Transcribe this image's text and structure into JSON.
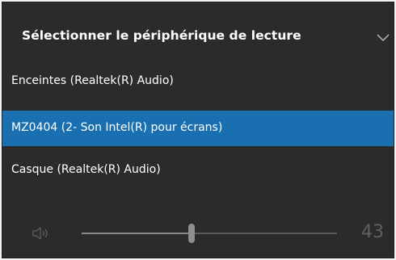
{
  "header": {
    "title": "Sélectionner le périphérique de lecture",
    "chevron_icon": "chevron-down-icon"
  },
  "devices": [
    {
      "label": "Enceintes (Realtek(R) Audio)",
      "selected": false
    },
    {
      "label": "MZ0404 (2- Son Intel(R) pour écrans)",
      "selected": true
    },
    {
      "label": "Casque (Realtek(R) Audio)",
      "selected": false
    }
  ],
  "volume": {
    "icon": "speaker-icon",
    "level": 43,
    "level_text": "43",
    "max": 100
  },
  "colors": {
    "panel_bg": "#2b2b2b",
    "selected_bg": "#1a6fb0",
    "text": "#ffffff",
    "muted": "#5f5f5f"
  }
}
